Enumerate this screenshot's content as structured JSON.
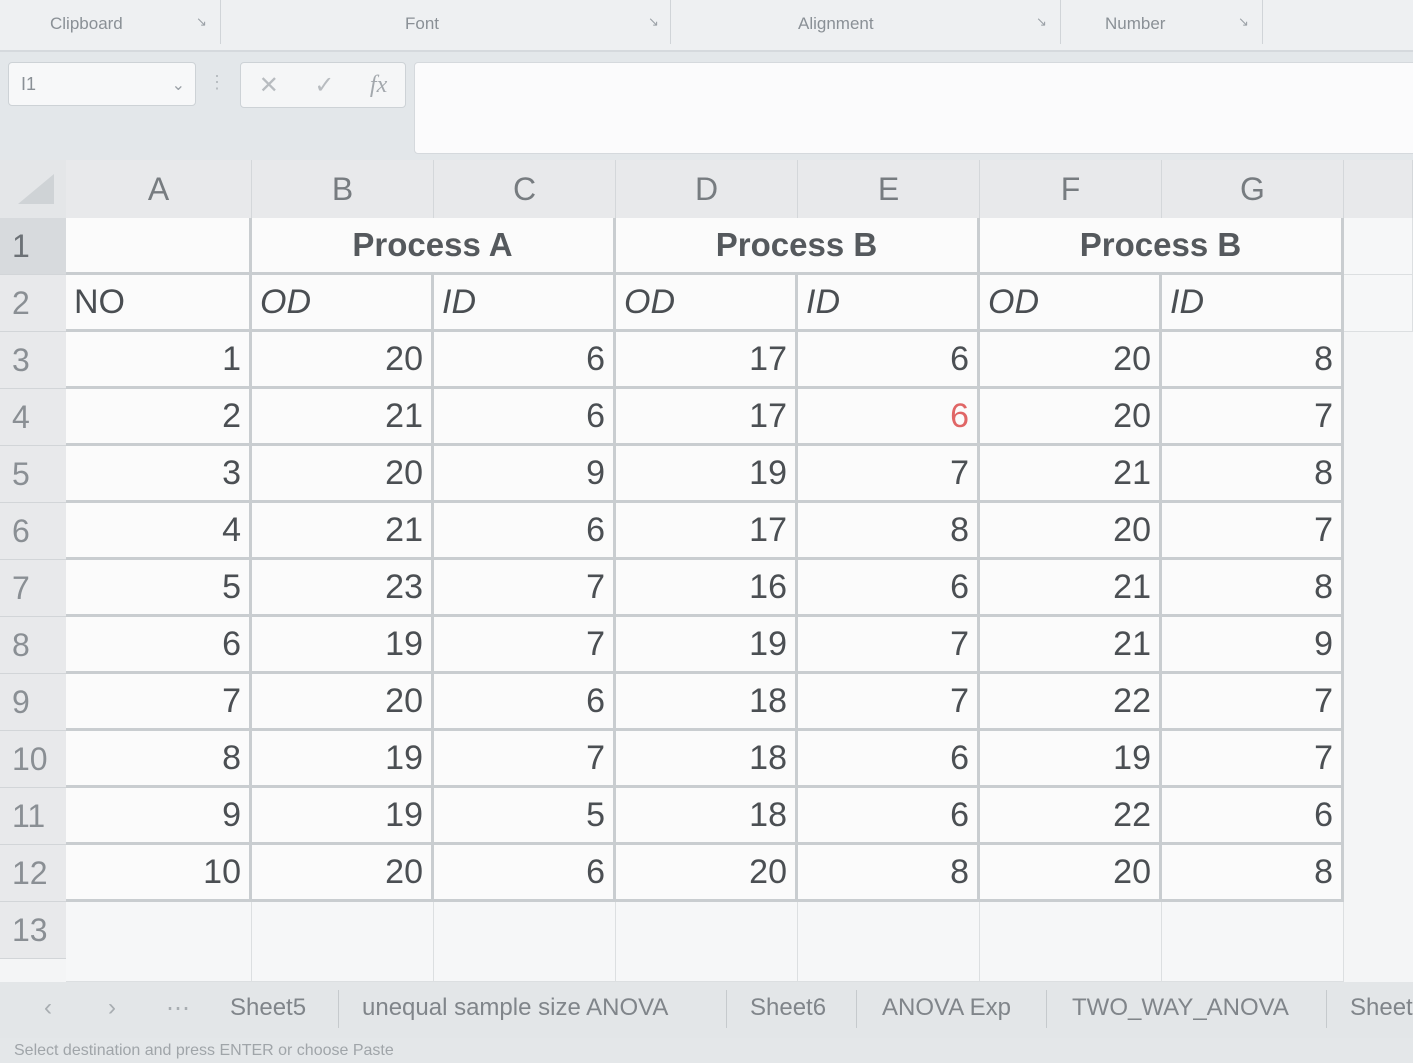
{
  "ribbon": {
    "groups": [
      "Clipboard",
      "Font",
      "Alignment",
      "Number"
    ]
  },
  "formula_bar": {
    "name_box": "I1",
    "formula": ""
  },
  "grid": {
    "columns": [
      "A",
      "B",
      "C",
      "D",
      "E",
      "F",
      "G"
    ],
    "rows": [
      "1",
      "2",
      "3",
      "4",
      "5",
      "6",
      "7",
      "8",
      "9",
      "10",
      "11",
      "12",
      "13"
    ],
    "row1": {
      "process_a": "Process A",
      "process_b1": "Process B",
      "process_b2": "Process B"
    },
    "row2": {
      "a": "NO",
      "b": "OD",
      "c": "ID",
      "d": "OD",
      "e": "ID",
      "f": "OD",
      "g": "ID"
    },
    "data": [
      [
        "1",
        "20",
        "6",
        "17",
        "6",
        "20",
        "8"
      ],
      [
        "2",
        "21",
        "6",
        "17",
        "6",
        "20",
        "7"
      ],
      [
        "3",
        "20",
        "9",
        "19",
        "7",
        "21",
        "8"
      ],
      [
        "4",
        "21",
        "6",
        "17",
        "8",
        "20",
        "7"
      ],
      [
        "5",
        "23",
        "7",
        "16",
        "6",
        "21",
        "8"
      ],
      [
        "6",
        "19",
        "7",
        "19",
        "7",
        "21",
        "9"
      ],
      [
        "7",
        "20",
        "6",
        "18",
        "7",
        "22",
        "7"
      ],
      [
        "8",
        "19",
        "7",
        "18",
        "6",
        "19",
        "7"
      ],
      [
        "9",
        "19",
        "5",
        "18",
        "6",
        "22",
        "6"
      ],
      [
        "10",
        "20",
        "6",
        "20",
        "8",
        "20",
        "8"
      ]
    ]
  },
  "sheet_tabs": [
    "Sheet5",
    "unequal sample size ANOVA",
    "Sheet6",
    "ANOVA Exp",
    "TWO_WAY_ANOVA",
    "Sheet"
  ],
  "status_bar": "Select destination and press ENTER or choose Paste",
  "colors": {
    "highlight_value": "#e06666",
    "grid_line": "#c9cdd0"
  }
}
